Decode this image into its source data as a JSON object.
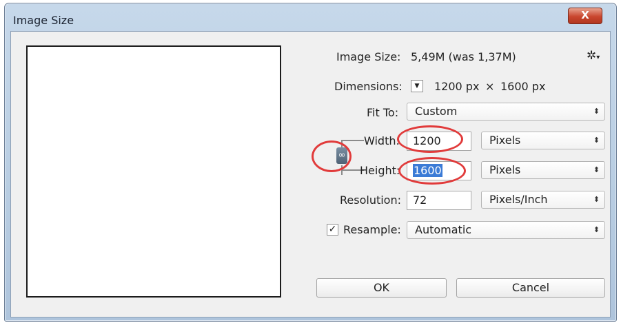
{
  "window": {
    "title": "Image Size",
    "close_label": "X"
  },
  "info": {
    "image_size_label": "Image Size:",
    "image_size_value": "5,49M (was 1,37M)",
    "dimensions_label": "Dimensions:",
    "dimensions_width": "1200 px",
    "dimensions_sep": "×",
    "dimensions_height": "1600 px"
  },
  "fit_to": {
    "label": "Fit To:",
    "value": "Custom"
  },
  "width": {
    "label": "Width:",
    "value": "1200",
    "unit": "Pixels"
  },
  "height": {
    "label": "Height:",
    "value": "1600",
    "unit": "Pixels"
  },
  "resolution": {
    "label": "Resolution:",
    "value": "72",
    "unit": "Pixels/Inch"
  },
  "resample": {
    "label": "Resample:",
    "checked": true,
    "value": "Automatic"
  },
  "buttons": {
    "ok": "OK",
    "cancel": "Cancel"
  },
  "icons": {
    "gear": "gear-icon",
    "chain": "chain-link-icon",
    "select_arrow": "updown-arrow-icon"
  },
  "colors": {
    "annotation": "#e13b3b",
    "selection": "#3b7bd6"
  }
}
